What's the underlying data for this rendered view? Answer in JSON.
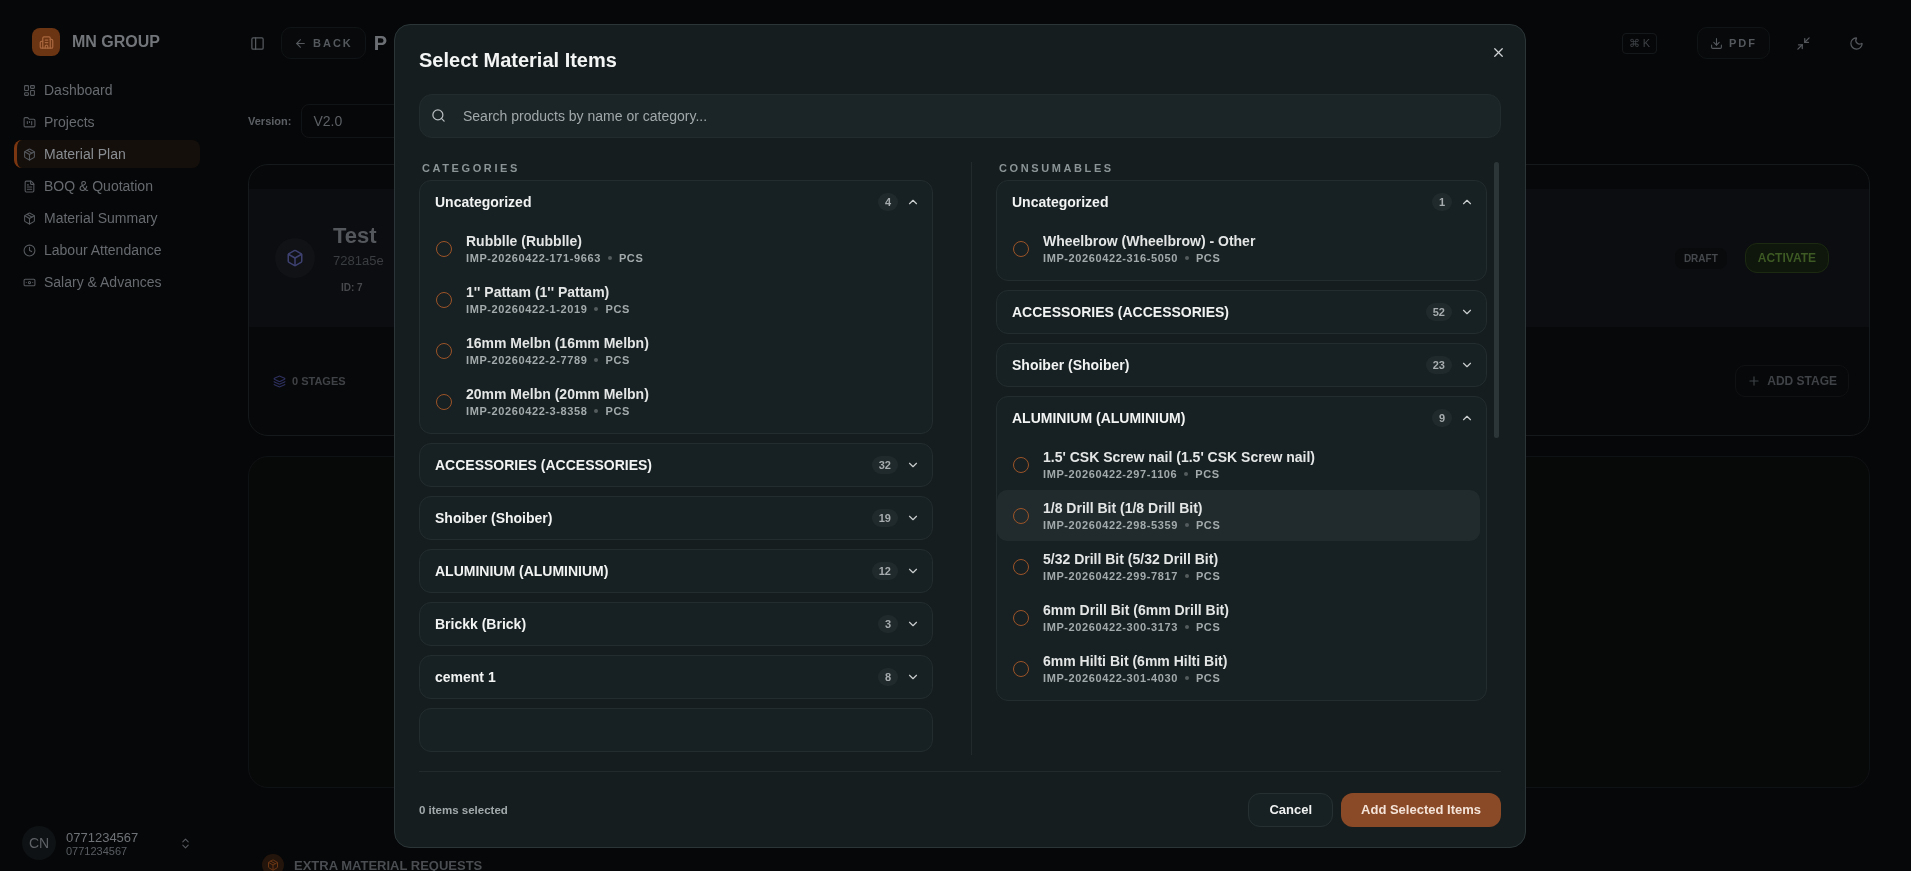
{
  "sidebar": {
    "brand": "MN GROUP",
    "items": [
      {
        "label": "Dashboard",
        "selected": false
      },
      {
        "label": "Projects",
        "selected": false
      },
      {
        "label": "Material Plan",
        "selected": true
      },
      {
        "label": "BOQ & Quotation",
        "selected": false
      },
      {
        "label": "Material Summary",
        "selected": false
      },
      {
        "label": "Labour Attendance",
        "selected": false
      },
      {
        "label": "Salary & Advances",
        "selected": false
      }
    ],
    "user": {
      "initials": "CN",
      "name": "0771234567",
      "detail": "0771234567"
    }
  },
  "header": {
    "back": "BACK",
    "title": "P",
    "shortcut": "⌘ K",
    "pdf": "PDF"
  },
  "version": {
    "label": "Version:",
    "value": "V2.0"
  },
  "project_card": {
    "title": "Test",
    "hash": "7281a5e",
    "id": "ID: 7",
    "stages": "0 STAGES",
    "status": "DRAFT",
    "activate": "ACTIVATE",
    "add_stage": "ADD STAGE"
  },
  "extra_requests": {
    "title": "EXTRA MATERIAL REQUESTS"
  },
  "dialog": {
    "title": "Select Material Items",
    "search": {
      "placeholder": "Search products by name or category..."
    },
    "columns": [
      {
        "heading": "CATEGORIES",
        "groups": [
          {
            "name": "Uncategorized",
            "count": "4",
            "expanded": true,
            "items": [
              {
                "name": "Rubblle (Rubblle)",
                "code": "IMP-20260422-171-9663",
                "unit": "PCS",
                "selected": false,
                "hovered": false
              },
              {
                "name": "1'' Pattam (1'' Pattam)",
                "code": "IMP-20260422-1-2019",
                "unit": "PCS",
                "selected": false,
                "hovered": false
              },
              {
                "name": "16mm Melbn (16mm Melbn)",
                "code": "IMP-20260422-2-7789",
                "unit": "PCS",
                "selected": false,
                "hovered": false
              },
              {
                "name": "20mm Melbn (20mm Melbn)",
                "code": "IMP-20260422-3-8358",
                "unit": "PCS",
                "selected": false,
                "hovered": false
              }
            ]
          },
          {
            "name": "ACCESSORIES (ACCESSORIES)",
            "count": "32",
            "expanded": false
          },
          {
            "name": "Shoiber (Shoiber)",
            "count": "19",
            "expanded": false
          },
          {
            "name": "ALUMINIUM (ALUMINIUM)",
            "count": "12",
            "expanded": false
          },
          {
            "name": "Brickk (Brick)",
            "count": "3",
            "expanded": false
          },
          {
            "name": "cement 1",
            "count": "8",
            "expanded": false
          }
        ],
        "more_below": true
      },
      {
        "heading": "CONSUMABLES",
        "groups": [
          {
            "name": "Uncategorized",
            "count": "1",
            "expanded": true,
            "items": [
              {
                "name": "Wheelbrow (Wheelbrow) - Other",
                "code": "IMP-20260422-316-5050",
                "unit": "PCS",
                "selected": false,
                "hovered": false
              }
            ]
          },
          {
            "name": "ACCESSORIES (ACCESSORIES)",
            "count": "52",
            "expanded": false
          },
          {
            "name": "Shoiber (Shoiber)",
            "count": "23",
            "expanded": false
          },
          {
            "name": "ALUMINIUM (ALUMINIUM)",
            "count": "9",
            "expanded": true,
            "items": [
              {
                "name": "1.5' CSK Screw nail (1.5' CSK Screw nail)",
                "code": "IMP-20260422-297-1106",
                "unit": "PCS",
                "selected": false,
                "hovered": false
              },
              {
                "name": "1/8 Drill Bit (1/8 Drill Bit)",
                "code": "IMP-20260422-298-5359",
                "unit": "PCS",
                "selected": false,
                "hovered": true
              },
              {
                "name": "5/32 Drill Bit (5/32 Drill Bit)",
                "code": "IMP-20260422-299-7817",
                "unit": "PCS",
                "selected": false,
                "hovered": false
              },
              {
                "name": "6mm Drill Bit (6mm Drill Bit)",
                "code": "IMP-20260422-300-3173",
                "unit": "PCS",
                "selected": false,
                "hovered": false
              },
              {
                "name": "6mm Hilti Bit (6mm Hilti Bit)",
                "code": "IMP-20260422-301-4030",
                "unit": "PCS",
                "selected": false,
                "hovered": false
              }
            ]
          }
        ]
      }
    ],
    "footer": {
      "count": "0 items selected",
      "cancel": "Cancel",
      "submit": "Add Selected Items"
    }
  }
}
